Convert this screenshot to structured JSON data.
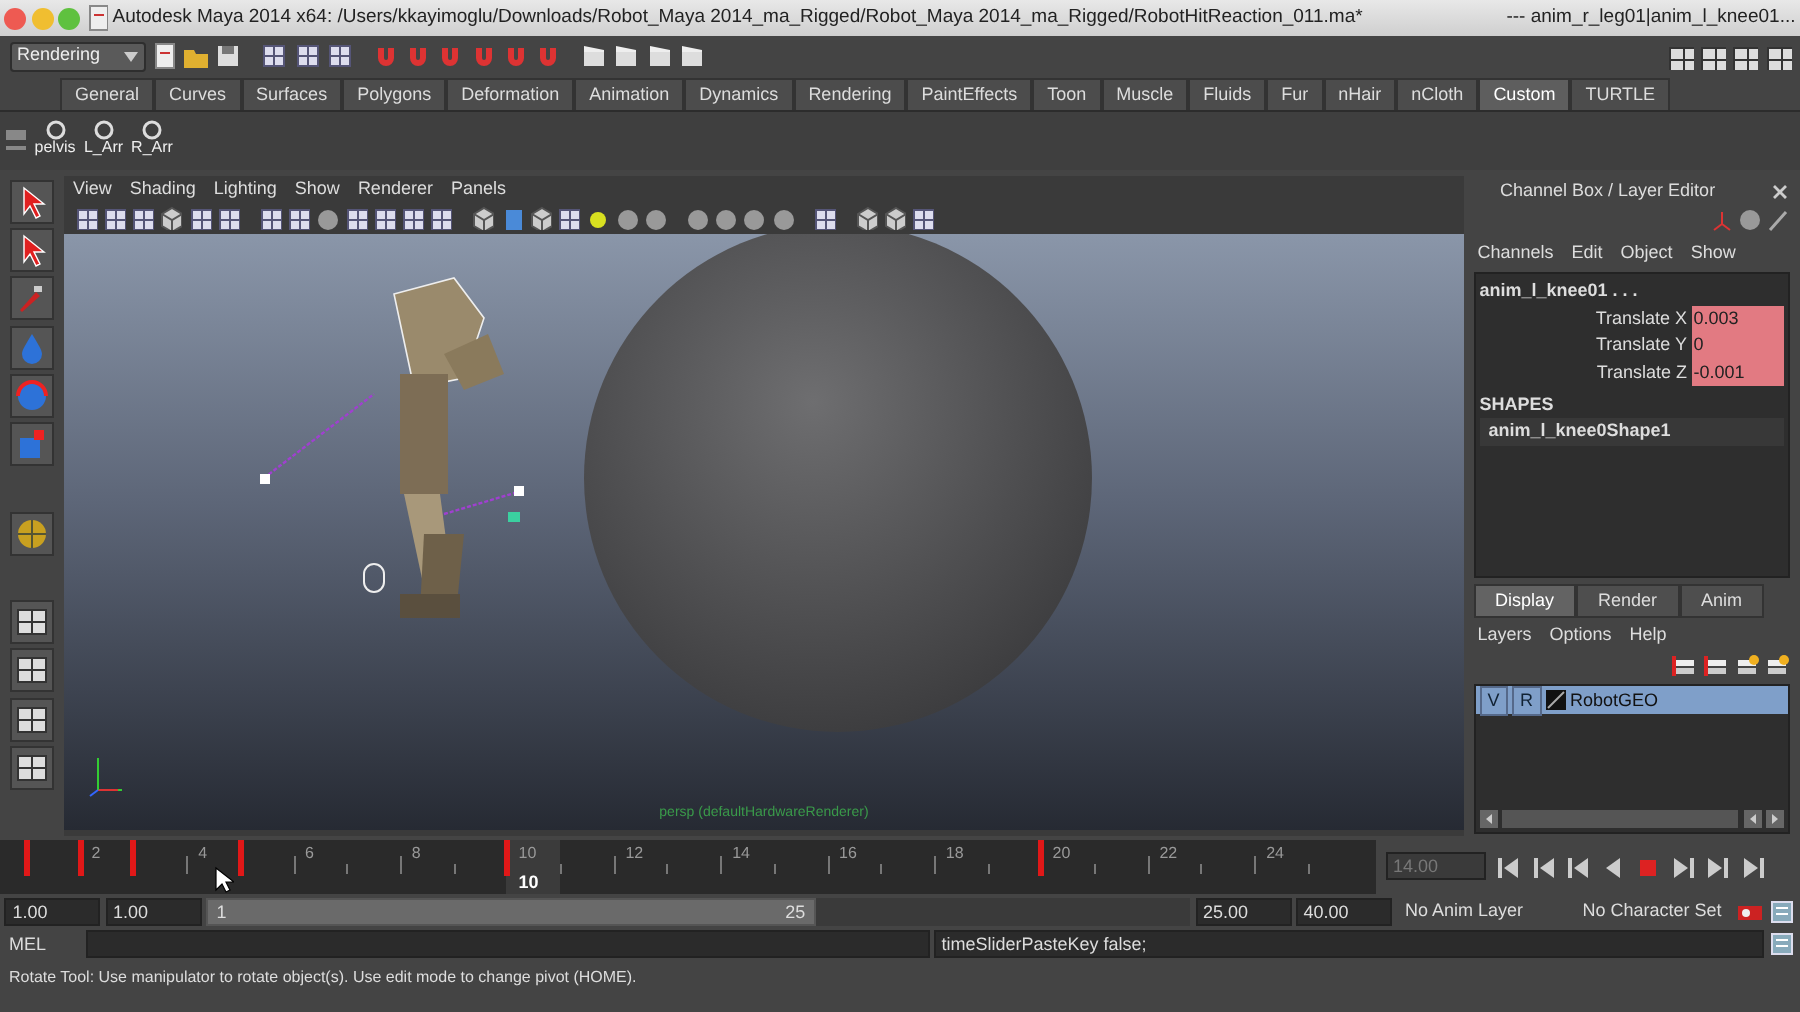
{
  "title_bar": {
    "title": "Autodesk Maya 2014 x64:  /Users/kkayimoglu/Downloads/Robot_Maya 2014_ma_Rigged/Robot_Maya 2014_ma_Rigged/RobotHitReaction_011.ma*",
    "right_text": "---    anim_r_leg01|anim_l_knee01..."
  },
  "status_line": {
    "menu_set": "Rendering"
  },
  "shelf": {
    "tabs": [
      {
        "label": "General",
        "selected": false
      },
      {
        "label": "Curves",
        "selected": false
      },
      {
        "label": "Surfaces",
        "selected": false
      },
      {
        "label": "Polygons",
        "selected": false
      },
      {
        "label": "Deformation",
        "selected": false
      },
      {
        "label": "Animation",
        "selected": false
      },
      {
        "label": "Dynamics",
        "selected": false
      },
      {
        "label": "Rendering",
        "selected": false
      },
      {
        "label": "PaintEffects",
        "selected": false
      },
      {
        "label": "Toon",
        "selected": false
      },
      {
        "label": "Muscle",
        "selected": false
      },
      {
        "label": "Fluids",
        "selected": false
      },
      {
        "label": "Fur",
        "selected": false
      },
      {
        "label": "nHair",
        "selected": false
      },
      {
        "label": "nCloth",
        "selected": false
      },
      {
        "label": "Custom",
        "selected": true
      },
      {
        "label": "TURTLE",
        "selected": false
      }
    ],
    "buttons": [
      {
        "label": "pelvis"
      },
      {
        "label": "L_Arr"
      },
      {
        "label": "R_Arr"
      }
    ]
  },
  "viewport": {
    "menus": [
      "View",
      "Shading",
      "Lighting",
      "Show",
      "Renderer",
      "Panels"
    ],
    "camera_label": "persp (defaultHardwareRenderer)"
  },
  "channel_box": {
    "title": "Channel Box / Layer Editor",
    "menus": [
      "Channels",
      "Edit",
      "Object",
      "Show"
    ],
    "object_name": "anim_l_knee01 . . .",
    "attributes": [
      {
        "name": "Translate X",
        "value": "0.003"
      },
      {
        "name": "Translate Y",
        "value": "0"
      },
      {
        "name": "Translate Z",
        "value": "-0.001"
      }
    ],
    "shapes_heading": "SHAPES",
    "shape_name": "anim_l_knee0Shape1"
  },
  "layer_editor": {
    "tabs": [
      {
        "label": "Display",
        "selected": true
      },
      {
        "label": "Render",
        "selected": false
      },
      {
        "label": "Anim",
        "selected": false
      }
    ],
    "menus": [
      "Layers",
      "Options",
      "Help"
    ],
    "layers": [
      {
        "visibility": "V",
        "reference": "R",
        "name": "RobotGEO",
        "selected": true
      }
    ]
  },
  "time_slider": {
    "ticks": [
      "2",
      "4",
      "6",
      "8",
      "10",
      "12",
      "14",
      "16",
      "18",
      "20",
      "22",
      "24"
    ],
    "current_frame": "10",
    "current_time": "14.00",
    "frames": [
      {
        "key": true
      },
      {
        "key": true
      },
      {
        "key": true
      },
      {
        "key": false
      },
      {
        "key": true
      },
      {
        "key": false
      },
      {
        "key": false
      },
      {
        "key": false
      },
      {
        "key": false
      },
      {
        "key": true
      },
      {
        "key": false
      },
      {
        "key": false
      },
      {
        "key": false
      },
      {
        "key": false
      },
      {
        "key": false
      },
      {
        "key": false
      },
      {
        "key": false
      },
      {
        "key": false
      },
      {
        "key": false
      },
      {
        "key": true
      },
      {
        "key": false
      },
      {
        "key": false
      },
      {
        "key": false
      },
      {
        "key": false
      },
      {
        "key": false
      }
    ]
  },
  "range_slider": {
    "level": 0.62,
    "start_time": "1.00",
    "playback_start": "1.00",
    "range_start": "1",
    "range_end": "25",
    "playback_end": "25.00",
    "end_time": "40.00",
    "anim_layer": "No Anim Layer",
    "character_set": "No Character Set"
  },
  "command_line": {
    "language": "MEL",
    "result": "timeSliderPasteKey false;"
  },
  "help_line": "Rotate Tool: Use manipulator to rotate object(s). Use edit mode to change pivot (HOME)."
}
